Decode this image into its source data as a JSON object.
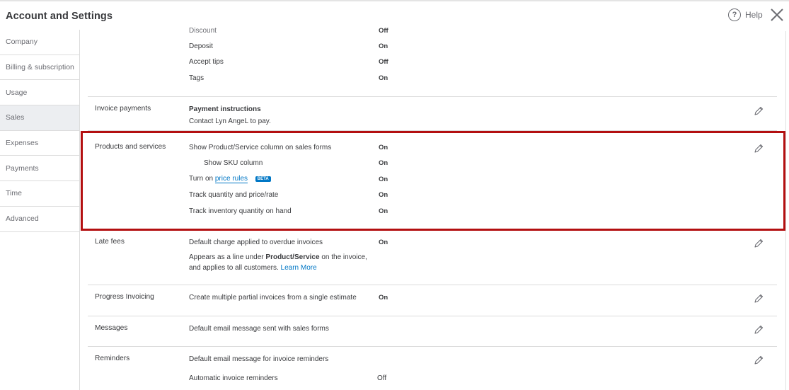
{
  "header": {
    "title": "Account and Settings",
    "help_label": "Help"
  },
  "sidebar": {
    "items": [
      {
        "label": "Company",
        "active": false
      },
      {
        "label": "Billing & subscription",
        "active": false
      },
      {
        "label": "Usage",
        "active": false
      },
      {
        "label": "Sales",
        "active": true
      },
      {
        "label": "Expenses",
        "active": false
      },
      {
        "label": "Payments",
        "active": false
      },
      {
        "label": "Time",
        "active": false
      },
      {
        "label": "Advanced",
        "active": false
      }
    ]
  },
  "sales_form_content": {
    "rows": [
      {
        "label": "Discount",
        "value": "Off"
      },
      {
        "label": "Deposit",
        "value": "On"
      },
      {
        "label": "Accept tips",
        "value": "Off"
      },
      {
        "label": "Tags",
        "value": "On"
      }
    ]
  },
  "invoice_payments": {
    "title": "Invoice payments",
    "heading": "Payment instructions",
    "text": "Contact Lyn AngeL to pay."
  },
  "products_services": {
    "title": "Products and services",
    "rows": [
      {
        "label": "Show Product/Service column on sales forms",
        "value": "On"
      },
      {
        "label": "Show SKU column",
        "value": "On"
      },
      {
        "label_prefix": "Turn on",
        "link": "price rules",
        "badge": "BETA",
        "value": "On"
      },
      {
        "label": "Track quantity and price/rate",
        "value": "On"
      },
      {
        "label": "Track inventory quantity on hand",
        "value": "On"
      }
    ]
  },
  "late_fees": {
    "title": "Late fees",
    "label": "Default charge applied to overdue invoices",
    "value": "On",
    "desc_line1_prefix": "Appears as a line under",
    "desc_line1_bold": "Product/Service",
    "desc_line1_suffix": "on the invoice,",
    "desc_line2": "and applies to all customers.",
    "learn_more": "Learn More"
  },
  "progress_invoicing": {
    "title": "Progress Invoicing",
    "label": "Create multiple partial invoices from a single estimate",
    "value": "On"
  },
  "messages": {
    "title": "Messages",
    "label": "Default email message sent with sales forms"
  },
  "reminders": {
    "title": "Reminders",
    "label": "Default email message for invoice reminders",
    "auto_label": "Automatic invoice reminders",
    "auto_value": "Off"
  },
  "colors": {
    "accent": "#0077c5",
    "highlight": "#b30f10",
    "active_nav": "#eceef1"
  }
}
